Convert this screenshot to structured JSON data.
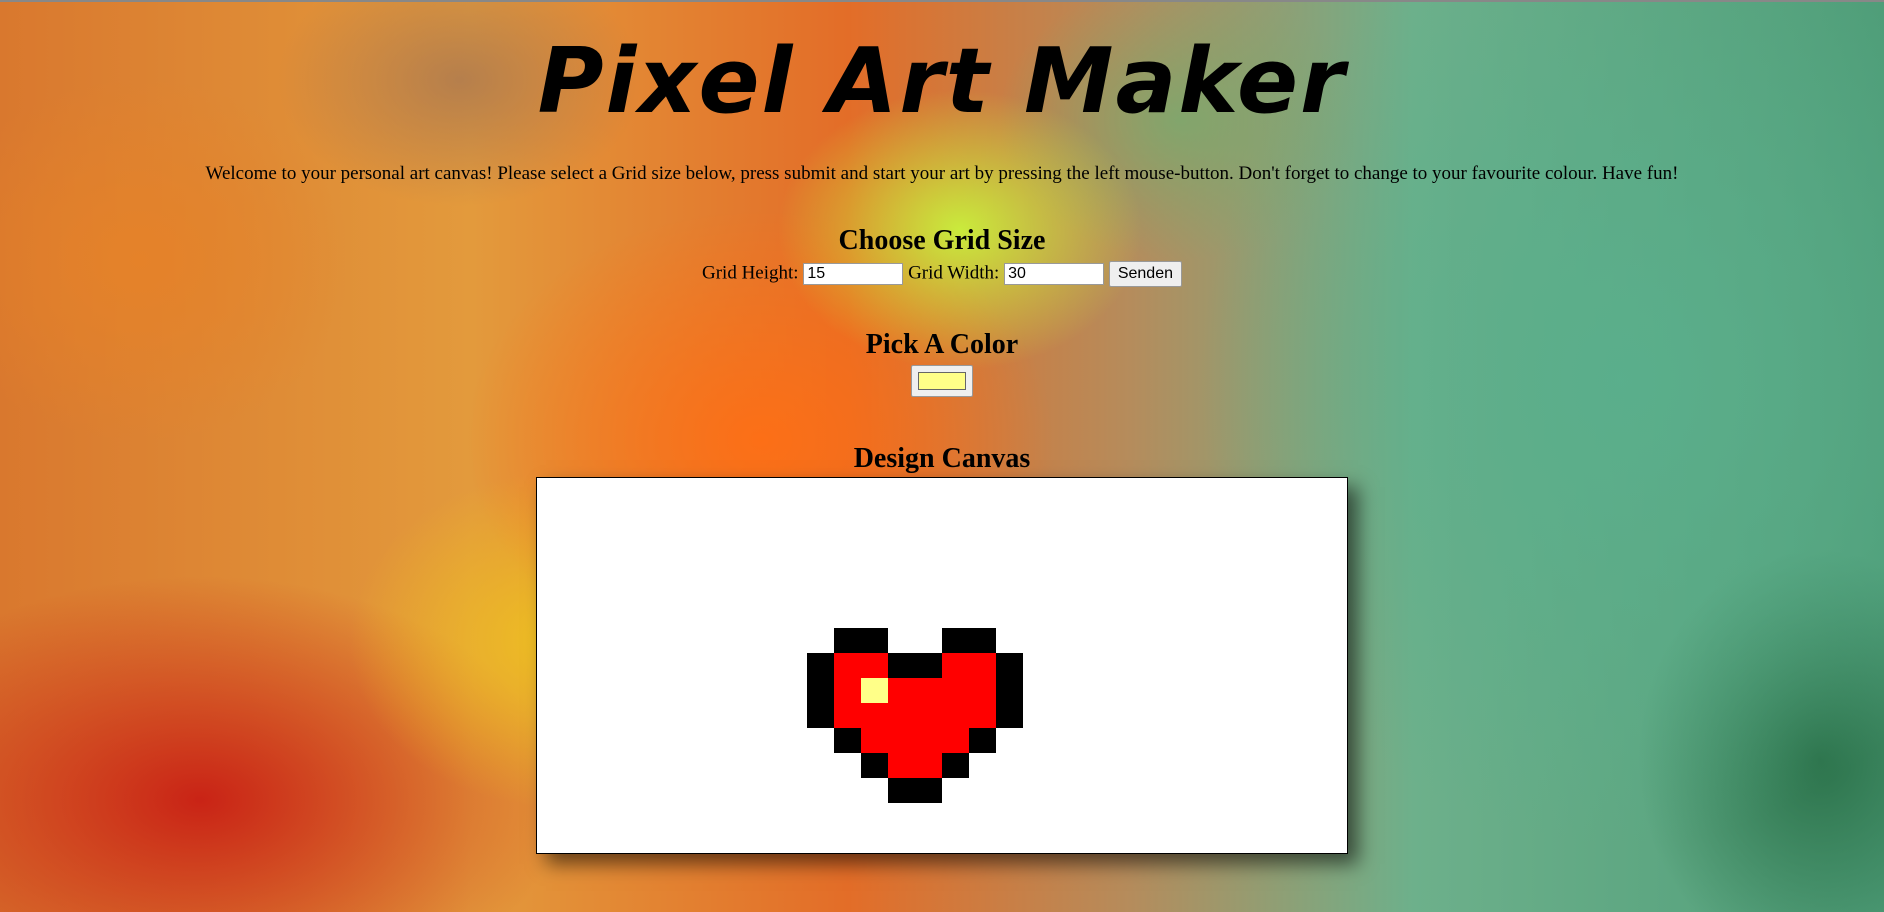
{
  "title": "Pixel Art Maker",
  "intro": "Welcome to your personal art canvas! Please select a Grid size below, press submit and start your art by pressing the left mouse-button. Don't forget to change to your favourite colour. Have fun!",
  "grid_form": {
    "heading": "Choose Grid Size",
    "height_label": "Grid Height:",
    "height_value": "15",
    "width_label": "Grid Width:",
    "width_value": "30",
    "submit_label": "Senden"
  },
  "color_section": {
    "heading": "Pick A Color",
    "selected_color": "#ffff88"
  },
  "canvas": {
    "heading": "Design Canvas",
    "rows": 15,
    "cols": 30,
    "palette": {
      "B": "#000000",
      "R": "#ff0000",
      "Y": "#ffff88"
    },
    "art": [
      "..............................",
      "..............................",
      "..............................",
      "..............................",
      "..............................",
      "..............................",
      "...........BB..BB.............",
      "..........BRRBBRRB............",
      "..........BRYRRRRB............",
      "..........BRRRRRRB............",
      "...........BRRRRB.............",
      "............BRRB..............",
      ".............BB...............",
      "..............................",
      ".............................."
    ]
  }
}
